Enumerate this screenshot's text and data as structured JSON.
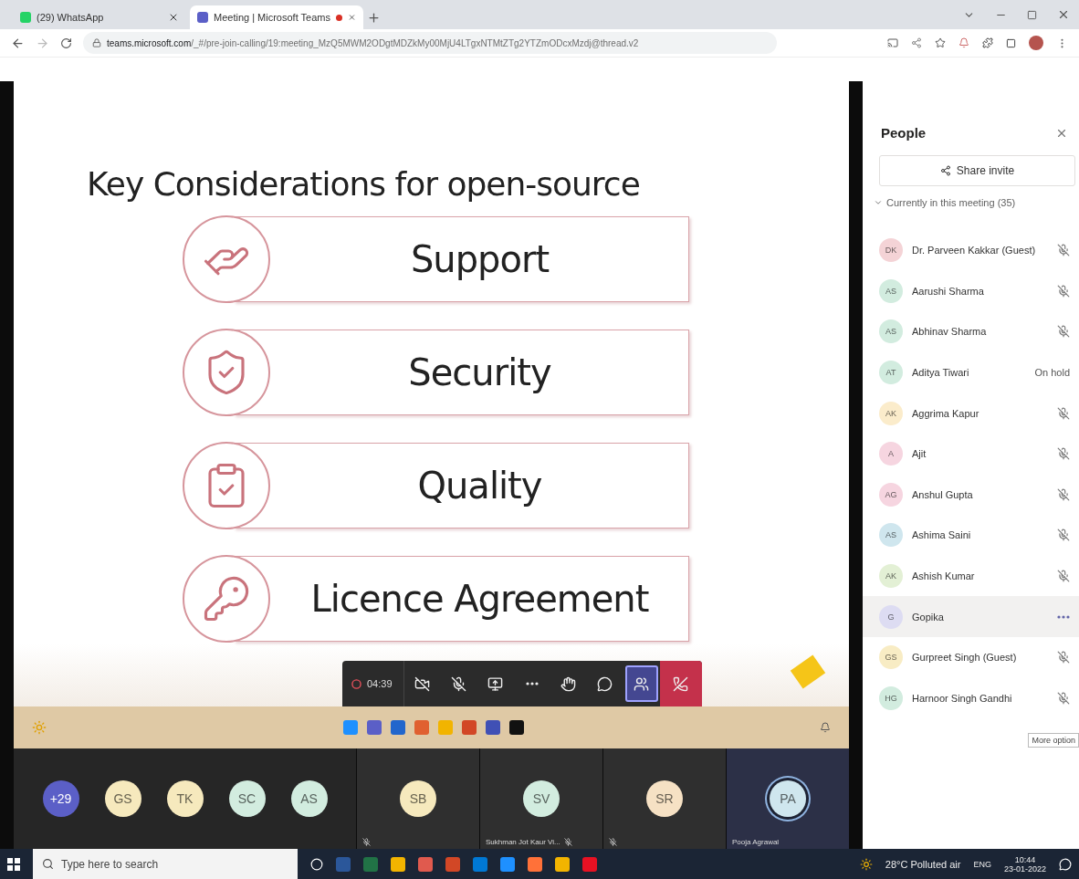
{
  "browser": {
    "tabs": [
      {
        "title": "(29) WhatsApp",
        "selected": false,
        "recording": false
      },
      {
        "title": "Meeting | Microsoft Teams",
        "selected": true,
        "recording": true
      }
    ],
    "url": {
      "host": "teams.microsoft.com",
      "path": "/_#/pre-join-calling/19:meeting_MzQ5MWM2ODgtMDZkMy00MjU4LTgxNTMtZTg2YTZmODcxMzdj@thread.v2"
    }
  },
  "slide": {
    "title": "Key Considerations for open-source",
    "items": [
      {
        "kind": "support",
        "label": "Support"
      },
      {
        "kind": "security",
        "label": "Security"
      },
      {
        "kind": "quality",
        "label": "Quality"
      },
      {
        "kind": "licence",
        "label": "Licence Agreement"
      }
    ]
  },
  "call_controls": {
    "timer": "04:39",
    "recording": true,
    "buttons": [
      {
        "kind": "camera",
        "selected": false
      },
      {
        "kind": "mic",
        "selected": false
      },
      {
        "kind": "share",
        "selected": false
      },
      {
        "kind": "more",
        "selected": false
      },
      {
        "kind": "hand",
        "selected": false
      },
      {
        "kind": "chat",
        "selected": false
      },
      {
        "kind": "people",
        "selected": true
      },
      {
        "kind": "leave",
        "selected": false
      }
    ]
  },
  "participants_strip": {
    "overflow": "+29",
    "avatars": [
      {
        "initials": "GS",
        "color": "#f6e9bd"
      },
      {
        "initials": "TK",
        "color": "#f6e9bd"
      },
      {
        "initials": "SC",
        "color": "#d2ecdf"
      },
      {
        "initials": "AS",
        "color": "#d2ecdf"
      }
    ],
    "tiles": [
      {
        "initials": "SB",
        "color": "#f6e9bd",
        "muted": true,
        "speaking": false
      },
      {
        "initials": "SV",
        "color": "#d2ecdf",
        "name": "Sukhman Jot Kaur Vi...",
        "muted": true,
        "speaking": false
      },
      {
        "initials": "SR",
        "color": "#f6e1c4",
        "muted": true,
        "speaking": false
      },
      {
        "initials": "PA",
        "color": "#cfe6ee",
        "name": "Pooja Agrawal",
        "muted": false,
        "speaking": true
      }
    ]
  },
  "people_panel": {
    "title": "People",
    "share_button": "Share invite",
    "section": {
      "label": "Currently in this meeting (35)",
      "expanded": true
    },
    "people": [
      {
        "initials": "DK",
        "name": "Dr. Parveen Kakkar (Guest)",
        "color": "#f4d3d6",
        "kind": "muted",
        "highlighted": false
      },
      {
        "initials": "AS",
        "name": "Aarushi Sharma",
        "color": "#d2ecdf",
        "kind": "muted",
        "highlighted": false
      },
      {
        "initials": "AS",
        "name": "Abhinav Sharma",
        "color": "#d2ecdf",
        "kind": "muted",
        "highlighted": false
      },
      {
        "initials": "AT",
        "name": "Aditya Tiwari",
        "color": "#d2ecdf",
        "kind": "text",
        "status_text": "On hold",
        "highlighted": false
      },
      {
        "initials": "AK",
        "name": "Aggrima Kapur",
        "color": "#fbeccb",
        "kind": "muted",
        "highlighted": false
      },
      {
        "initials": "A",
        "name": "Ajit",
        "color": "#f6d5e0",
        "kind": "muted",
        "highlighted": false
      },
      {
        "initials": "AG",
        "name": "Anshul Gupta",
        "color": "#f6d5e0",
        "kind": "muted",
        "highlighted": false
      },
      {
        "initials": "AS",
        "name": "Ashima Saini",
        "color": "#cfe6ee",
        "kind": "muted",
        "highlighted": false
      },
      {
        "initials": "AK",
        "name": "Ashish Kumar",
        "color": "#e3f0d5",
        "kind": "muted",
        "highlighted": false
      },
      {
        "initials": "G",
        "name": "Gopika",
        "color": "#dddcf2",
        "kind": "more",
        "highlighted": true
      },
      {
        "initials": "GS",
        "name": "Gurpreet Singh (Guest)",
        "color": "#f8ecc4",
        "kind": "muted",
        "highlighted": false
      },
      {
        "initials": "HG",
        "name": "Harnoor Singh Gandhi",
        "color": "#d2ecdf",
        "kind": "muted",
        "highlighted": false
      }
    ],
    "tooltip": "More option"
  },
  "taskbar": {
    "search_placeholder": "Type here to search",
    "weather": "28°C Polluted air",
    "language": "ENG",
    "time": "10:44",
    "date": "23-01-2022"
  }
}
